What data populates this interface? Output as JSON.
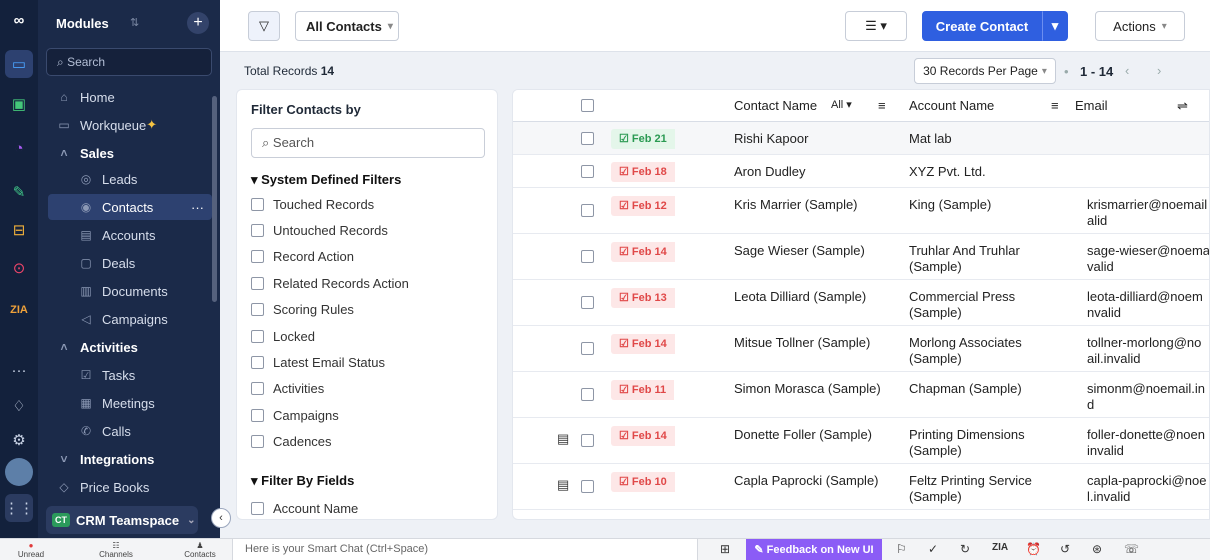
{
  "rail": {
    "icons": [
      "link-logo-icon",
      "folder-icon",
      "analytics-icon",
      "circle-icon",
      "edit-icon",
      "cart-icon",
      "search-icon",
      "zia-icon",
      "more-icon",
      "bell-icon",
      "gear-icon",
      "avatar",
      "apps-grid-icon"
    ],
    "labels": {
      "zia": "ZIA"
    }
  },
  "sidebar": {
    "title": "Modules",
    "search_placeholder": "Search",
    "items": [
      {
        "label": "Home",
        "icon": "home-icon"
      },
      {
        "label": "Workqueue",
        "icon": "workqueue-icon"
      },
      {
        "label": "Sales",
        "icon": "chevron-up-icon",
        "bold": true
      },
      {
        "label": "Leads",
        "icon": "leads-icon"
      },
      {
        "label": "Contacts",
        "icon": "contacts-icon",
        "active": true
      },
      {
        "label": "Accounts",
        "icon": "accounts-icon"
      },
      {
        "label": "Deals",
        "icon": "deals-icon"
      },
      {
        "label": "Documents",
        "icon": "documents-icon"
      },
      {
        "label": "Campaigns",
        "icon": "campaigns-icon"
      },
      {
        "label": "Activities",
        "icon": "chevron-up-icon",
        "bold": true
      },
      {
        "label": "Tasks",
        "icon": "tasks-icon"
      },
      {
        "label": "Meetings",
        "icon": "meetings-icon"
      },
      {
        "label": "Calls",
        "icon": "calls-icon"
      },
      {
        "label": "Integrations",
        "icon": "chevron-down-icon",
        "bold": true
      },
      {
        "label": "Price Books",
        "icon": "price-books-icon"
      }
    ],
    "team": {
      "badge": "CT",
      "label": "CRM Teamspace"
    }
  },
  "toolbar": {
    "view": "All Contacts",
    "create": "Create Contact",
    "actions": "Actions"
  },
  "subbar": {
    "total_label": "Total Records",
    "total_value": "14",
    "per_page": "30 Records Per Page",
    "range": "1 - 14"
  },
  "filters": {
    "title": "Filter Contacts by",
    "search_placeholder": "Search",
    "system_title": "System Defined Filters",
    "system": [
      "Touched Records",
      "Untouched Records",
      "Record Action",
      "Related Records Action",
      "Scoring Rules",
      "Locked",
      "Latest Email Status",
      "Activities",
      "Campaigns",
      "Cadences"
    ],
    "fields_title": "Filter By Fields",
    "fields": [
      "Account Name"
    ]
  },
  "table": {
    "headers": {
      "contact": "Contact Name",
      "all": "All",
      "account": "Account Name",
      "email": "Email"
    },
    "rows": [
      {
        "date": "Feb 21",
        "status": "green",
        "name": "Rishi Kapoor",
        "account": "Mat lab",
        "email": "",
        "note": false
      },
      {
        "date": "Feb 18",
        "status": "red",
        "name": "Aron Dudley",
        "account": "XYZ Pvt. Ltd.",
        "email": "",
        "note": false
      },
      {
        "date": "Feb 12",
        "status": "red",
        "name": "Kris Marrier (Sample)",
        "account": "King (Sample)",
        "email": "krismarrier@noemail\nalid",
        "note": false
      },
      {
        "date": "Feb 14",
        "status": "red",
        "name": "Sage Wieser (Sample)",
        "account": "Truhlar And Truhlar\n(Sample)",
        "email": "sage-wieser@noema\nvalid",
        "note": false
      },
      {
        "date": "Feb 13",
        "status": "red",
        "name": "Leota Dilliard (Sample)",
        "account": "Commercial Press (Sample)",
        "email": "leota-dilliard@noem\nnvalid",
        "note": false
      },
      {
        "date": "Feb 14",
        "status": "red",
        "name": "Mitsue Tollner (Sample)",
        "account": "Morlong Associates\n(Sample)",
        "email": "tollner-morlong@no\nail.invalid",
        "note": false
      },
      {
        "date": "Feb 11",
        "status": "red",
        "name": "Simon Morasca (Sample)",
        "account": "Chapman (Sample)",
        "email": "simonm@noemail.in\nd",
        "note": false
      },
      {
        "date": "Feb 14",
        "status": "red",
        "name": "Donette Foller (Sample)",
        "account": "Printing Dimensions\n(Sample)",
        "email": "foller-donette@noen\ninvalid",
        "note": true
      },
      {
        "date": "Feb 10",
        "status": "red",
        "name": "Capla Paprocki (Sample)",
        "account": "Feltz Printing Service\n(Sample)",
        "email": "capla-paprocki@noe\nl.invalid",
        "note": true
      }
    ]
  },
  "bottombar": {
    "unread": "Unread Chats",
    "channels": "Channels",
    "contacts": "Contacts",
    "smartchat": "Here is your Smart Chat (Ctrl+Space)",
    "feedback": "Feedback on New UI"
  }
}
